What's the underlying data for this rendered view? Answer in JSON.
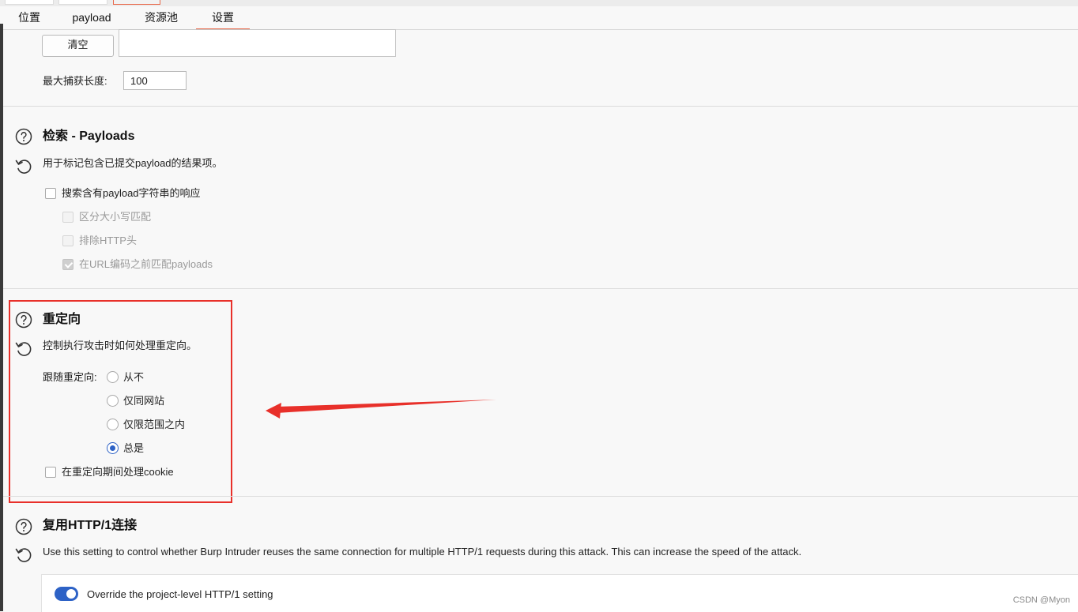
{
  "tabs": [
    "位置",
    "payload",
    "资源池",
    "设置"
  ],
  "active_tab": "设置",
  "grep_extract": {
    "clear_button": "清空",
    "max_capture_label": "最大捕获长度:",
    "max_capture_value": "100"
  },
  "grep_payloads": {
    "title": "检索 - Payloads",
    "description": "用于标记包含已提交payload的结果项。",
    "options": [
      {
        "label": "搜索含有payload字符串的响应",
        "checked": false,
        "enabled": true
      },
      {
        "label": "区分大小写匹配",
        "checked": false,
        "enabled": false
      },
      {
        "label": "排除HTTP头",
        "checked": false,
        "enabled": false
      },
      {
        "label": "在URL编码之前匹配payloads",
        "checked": true,
        "enabled": false
      }
    ]
  },
  "redirections": {
    "title": "重定向",
    "description": "控制执行攻击时如何处理重定向。",
    "follow_label": "跟随重定向:",
    "radio_options": [
      "从不",
      "仅同网站",
      "仅限范围之内",
      "总是"
    ],
    "selected": "总是",
    "cookie_option": "在重定向期间处理cookie",
    "cookie_checked": false
  },
  "http1_reuse": {
    "title": "复用HTTP/1连接",
    "description": "Use this setting to control whether Burp Intruder reuses the same connection for multiple HTTP/1 requests during this attack. This can increase the speed of the attack.",
    "override_label": "Override the project-level HTTP/1 setting",
    "override_on": true
  },
  "annotation": {
    "highlight_color": "#e8302a",
    "arrow_color": "#e8302a"
  },
  "accent_color": "#e8684a",
  "control_color": "#2d62c6",
  "icons": {
    "help": "help-circle-icon",
    "reset": "reset-icon"
  },
  "watermark": "CSDN @Myon⁠"
}
